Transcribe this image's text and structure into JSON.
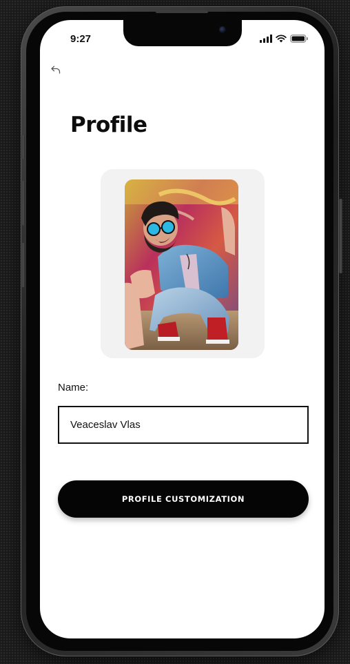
{
  "status_bar": {
    "time": "9:27",
    "icons": [
      "signal-icon",
      "wifi-icon",
      "battery-icon"
    ]
  },
  "nav": {
    "back_icon": "back-arrow-icon"
  },
  "page": {
    "title": "Profile"
  },
  "avatar": {
    "description_icon": "profile-photo"
  },
  "form": {
    "name_label": "Name:",
    "name_value": "Veaceslav Vlas"
  },
  "actions": {
    "customize_label": "PROFILE CUSTOMIZATION"
  },
  "colors": {
    "background": "#ffffff",
    "button": "#050505",
    "button_text": "#ffffff",
    "card": "#f2f2f2",
    "frame": "#1b1b1b"
  }
}
